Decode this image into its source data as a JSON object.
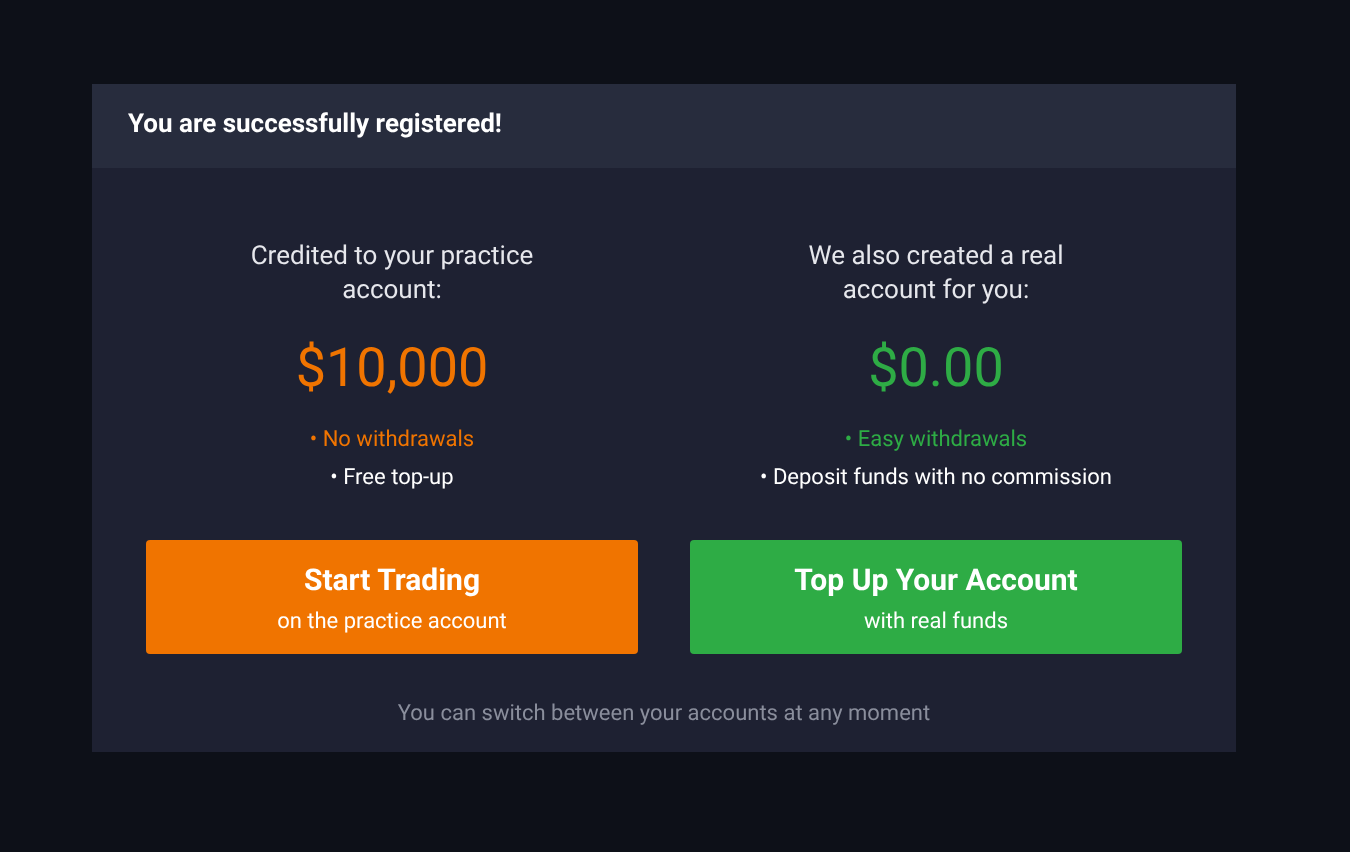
{
  "dialog": {
    "title": "You are successfully registered!"
  },
  "accounts": [
    {
      "caption": "Credited to your practice account:",
      "amount": "$10,000",
      "color": "#f07400",
      "features": [
        {
          "text": "• No withdrawals",
          "highlighted": true
        },
        {
          "text": "• Free top-up",
          "highlighted": false
        }
      ],
      "button": {
        "label": "Start Trading",
        "sublabel": "on the practice account",
        "color": "#f07400"
      }
    },
    {
      "caption": "We also created a real account for you:",
      "amount": "$0.00",
      "color": "#2eac45",
      "features": [
        {
          "text": "• Easy withdrawals",
          "highlighted": true
        },
        {
          "text": "• Deposit funds with no commission",
          "highlighted": false
        }
      ],
      "button": {
        "label": "Top Up Your Account",
        "sublabel": "with real funds",
        "color": "#2eac45"
      }
    }
  ],
  "footer": "You can switch between your accounts at any moment"
}
